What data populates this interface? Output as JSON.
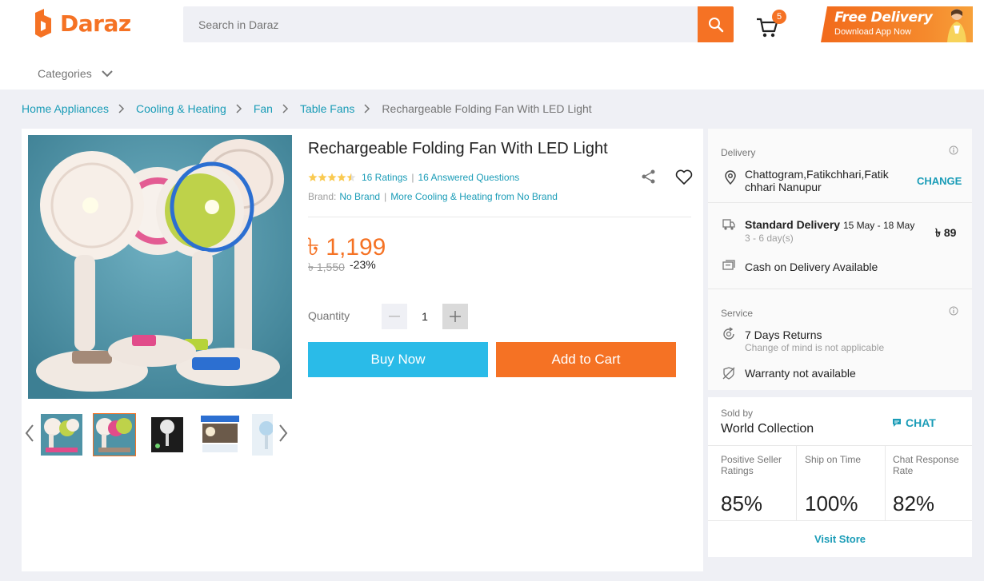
{
  "header": {
    "logo_text": "Daraz",
    "search_placeholder": "Search in Daraz",
    "cart_count": "5",
    "promo_title": "Free Delivery",
    "promo_sub": "Download App Now",
    "categories_label": "Categories"
  },
  "breadcrumb": {
    "items": [
      "Home Appliances",
      "Cooling & Heating",
      "Fan",
      "Table Fans"
    ],
    "current": "Rechargeable Folding Fan With LED Light"
  },
  "product": {
    "title": "Rechargeable Folding Fan With LED Light",
    "rating": 4.5,
    "ratings_label": "16 Ratings",
    "questions_label": "16 Answered Questions",
    "brand_label": "Brand:",
    "brand_value": "No Brand",
    "more_from": "More Cooling & Heating from No Brand",
    "price": "৳ 1,199",
    "original_price": "৳ 1,550",
    "discount": "-23%",
    "quantity_label": "Quantity",
    "quantity": "1",
    "buy_now": "Buy Now",
    "add_to_cart": "Add to Cart",
    "thumbnails": 5,
    "active_thumbnail": 2
  },
  "delivery": {
    "section_label": "Delivery",
    "location": "Chattogram,Fatikchhari,Fatik chhari Nanupur",
    "change": "CHANGE",
    "standard_label": "Standard Delivery",
    "standard_dates": "15 May - 18 May",
    "standard_days": "3 - 6 day(s)",
    "standard_price": "৳ 89",
    "cod": "Cash on Delivery Available"
  },
  "service": {
    "section_label": "Service",
    "returns": "7 Days Returns",
    "returns_sub": "Change of mind is not applicable",
    "warranty": "Warranty not available"
  },
  "seller": {
    "sold_by_label": "Sold by",
    "name": "World Collection",
    "chat": "CHAT",
    "metrics": [
      {
        "label": "Positive Seller Ratings",
        "value": "85%"
      },
      {
        "label": "Ship on Time",
        "value": "100%"
      },
      {
        "label": "Chat Response Rate",
        "value": "82%"
      }
    ],
    "visit_store": "Visit Store"
  },
  "colors": {
    "brand_orange": "#f57224",
    "link_blue": "#1a9cb7",
    "buy_now_blue": "#2abbe8",
    "page_bg": "#eff0f5",
    "star_yellow": "#faca51"
  }
}
